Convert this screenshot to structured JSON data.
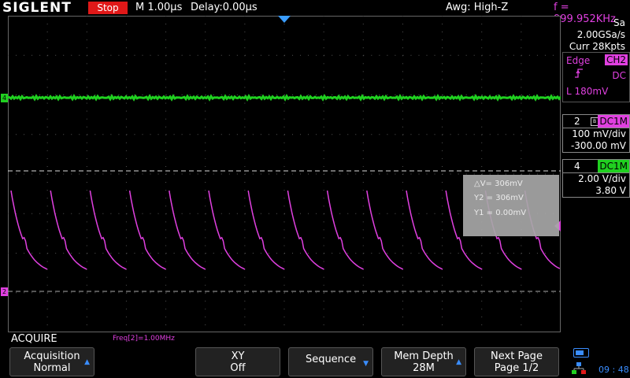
{
  "header": {
    "brand": "SIGLENT",
    "run_state": "Stop",
    "timebase": "M 1.00μs",
    "delay": "Delay:0.00μs",
    "awg": "Awg: High-Z",
    "frequency": "f = 999.952KHz"
  },
  "acquisition_info": {
    "sample_rate": "Sa 2.00GSa/s",
    "memory": "Curr 28Kpts"
  },
  "trigger": {
    "type": "Edge",
    "source": "CH2",
    "coupling": "DC",
    "level": "L  180mV"
  },
  "channels": [
    {
      "number": "2",
      "coupling": "DC1M",
      "scale": "100 mV/div",
      "offset": "-300.00 mV",
      "color": "#e040e0"
    },
    {
      "number": "4",
      "coupling": "DC1M",
      "scale": "2.00 V/div",
      "offset": "3.80 V",
      "color": "#20d020"
    }
  ],
  "cursor_readout": {
    "delta_v": "△V= 306mV",
    "y2": "Y2 = 306mV",
    "y1": "Y1 = 0.00mV"
  },
  "marker_labels": {
    "ch4": "4",
    "ch2": "2"
  },
  "menu_title": "ACQUIRE",
  "measurement": "Freq[2]=1.00MHz",
  "softkeys": [
    {
      "line1": "Acquisition",
      "line2": "Normal",
      "arrow": "▲"
    },
    {
      "line1": "XY",
      "line2": "Off",
      "arrow": ""
    },
    {
      "line1": "Sequence",
      "line2": "",
      "arrow": "▼"
    },
    {
      "line1": "Mem Depth",
      "line2": "28M",
      "arrow": "▲"
    },
    {
      "line1": "Next Page",
      "line2": "Page 1/2",
      "arrow": ""
    }
  ],
  "clock": "09 : 48",
  "waveform": {
    "periods": 13,
    "ch2_color": "#e040e0",
    "ch4_color": "#20d020"
  }
}
